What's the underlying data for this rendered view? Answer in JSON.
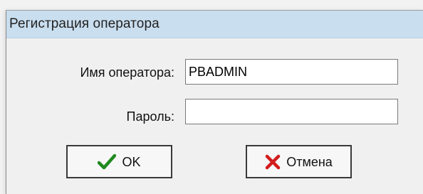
{
  "window": {
    "title": "Регистрация оператора"
  },
  "form": {
    "operator_label": "Имя оператора:",
    "operator_value": "PBADMIN",
    "password_label": "Пароль:",
    "password_value": ""
  },
  "buttons": {
    "ok_label": "OK",
    "cancel_label": "Отмена"
  },
  "icons": {
    "ok": "checkmark-icon",
    "cancel": "cross-icon"
  },
  "colors": {
    "titlebar": "#c9deef",
    "ok_icon": "#1f8a1f",
    "cancel_icon": "#d21d1d"
  }
}
